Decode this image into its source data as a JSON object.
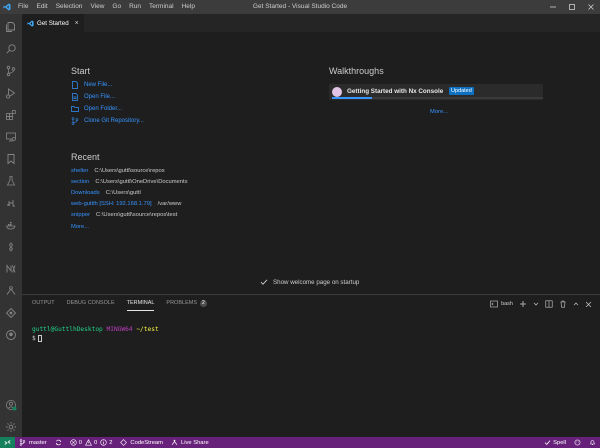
{
  "titlebar": {
    "menu": [
      "File",
      "Edit",
      "Selection",
      "View",
      "Go",
      "Run",
      "Terminal",
      "Help"
    ],
    "window_title": "Get Started - Visual Studio Code"
  },
  "editor": {
    "tab_label": "Get Started",
    "tab_close": "×"
  },
  "welcome": {
    "start_title": "Start",
    "start_items": [
      "New File...",
      "Open File...",
      "Open Folder...",
      "Clone Git Repository..."
    ],
    "recent_title": "Recent",
    "recent": [
      {
        "name": "shelter",
        "path": "C:\\Users\\guttl\\source\\repos"
      },
      {
        "name": "section",
        "path": "C:\\Users\\guttl\\OneDrive\\Documents"
      },
      {
        "name": "Downloads",
        "path": "C:\\Users\\guttl"
      },
      {
        "name": "web-guttlh [SSH: 192.168.1.79]",
        "path": "/var/www"
      },
      {
        "name": "snipper",
        "path": "C:\\Users\\guttl\\source\\repos\\test"
      }
    ],
    "recent_more": "More...",
    "walkthroughs_title": "Walkthroughs",
    "walkthrough": {
      "title": "Getting Started with Nx Console",
      "badge": "Updated",
      "progress": 0.19
    },
    "walkthroughs_more": "More...",
    "show_on_startup_label": "Show welcome page on startup",
    "show_on_startup_checked": true
  },
  "panel": {
    "tabs": [
      "OUTPUT",
      "DEBUG CONSOLE",
      "TERMINAL",
      "PROBLEMS"
    ],
    "active_tab": "TERMINAL",
    "problems_count": "2",
    "shell": "bash",
    "terminal": {
      "user": "guttl@GuttlhDesktop",
      "env": "MINGW64",
      "path": "~/test",
      "prompt": "$"
    }
  },
  "statusbar": {
    "branch": "master",
    "errors": "0",
    "warnings": "0",
    "info": "2",
    "codestream": "CodeStream",
    "live_share": "Live Share",
    "spell": "Spell"
  },
  "colors": {
    "statusbar": "#68217a",
    "accent": "#3794ff",
    "activitybar": "#333333",
    "titlebar": "#3c3c3c",
    "editor_bg": "#1e1e1e"
  }
}
